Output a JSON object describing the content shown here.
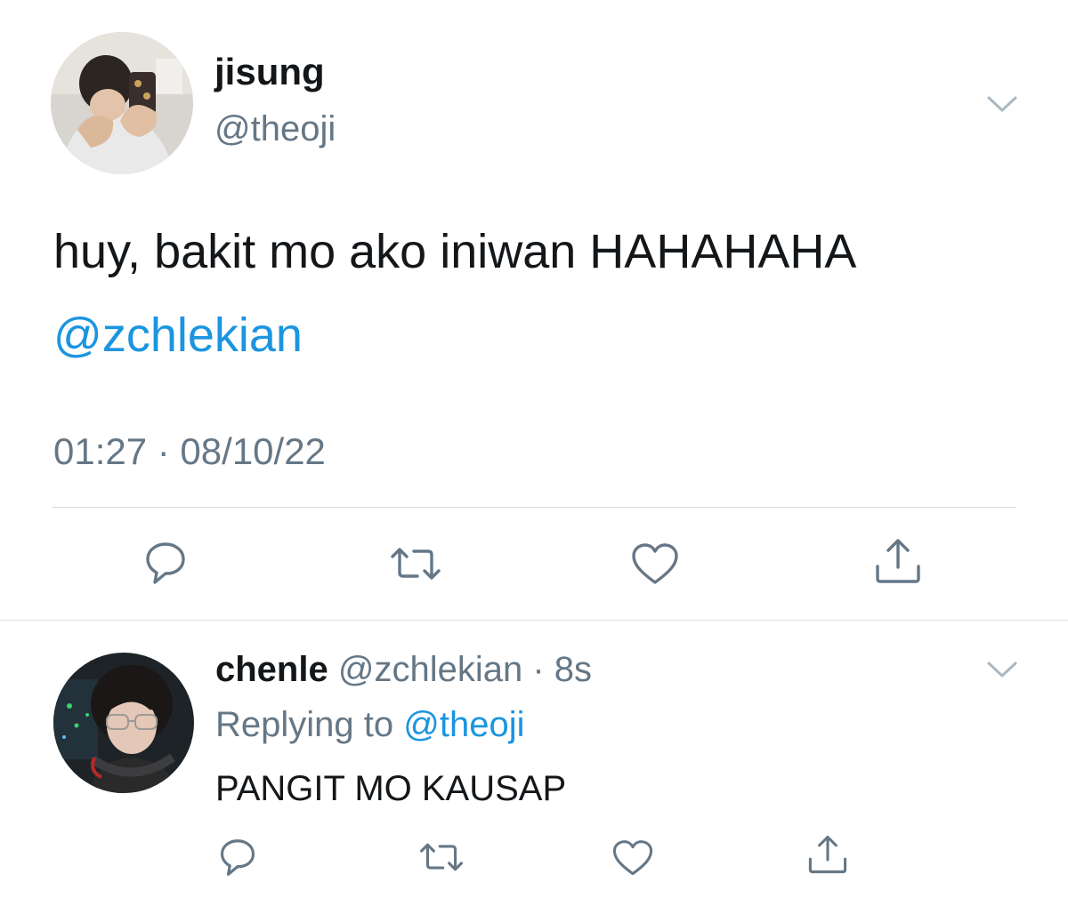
{
  "main_tweet": {
    "name": "jisung",
    "handle": "@theoji",
    "text": "huy, bakit mo ako iniwan HAHAHAHA",
    "mention": "@zchlekian",
    "timestamp": "01:27 · 08/10/22",
    "actions": [
      "reply-icon",
      "retweet-icon",
      "like-icon",
      "share-icon"
    ]
  },
  "reply_tweet": {
    "name": "chenle",
    "handle": "@zchlekian",
    "separator": " · ",
    "time": "8s",
    "replying_prefix": "Replying to ",
    "replying_to": "@theoji",
    "text": "PANGIT MO KAUSAP",
    "actions": [
      "reply-icon",
      "retweet-icon",
      "like-icon",
      "share-icon"
    ]
  },
  "colors": {
    "text": "#14171a",
    "secondary": "#657786",
    "link": "#1b95e0",
    "divider": "#d9dde1"
  }
}
